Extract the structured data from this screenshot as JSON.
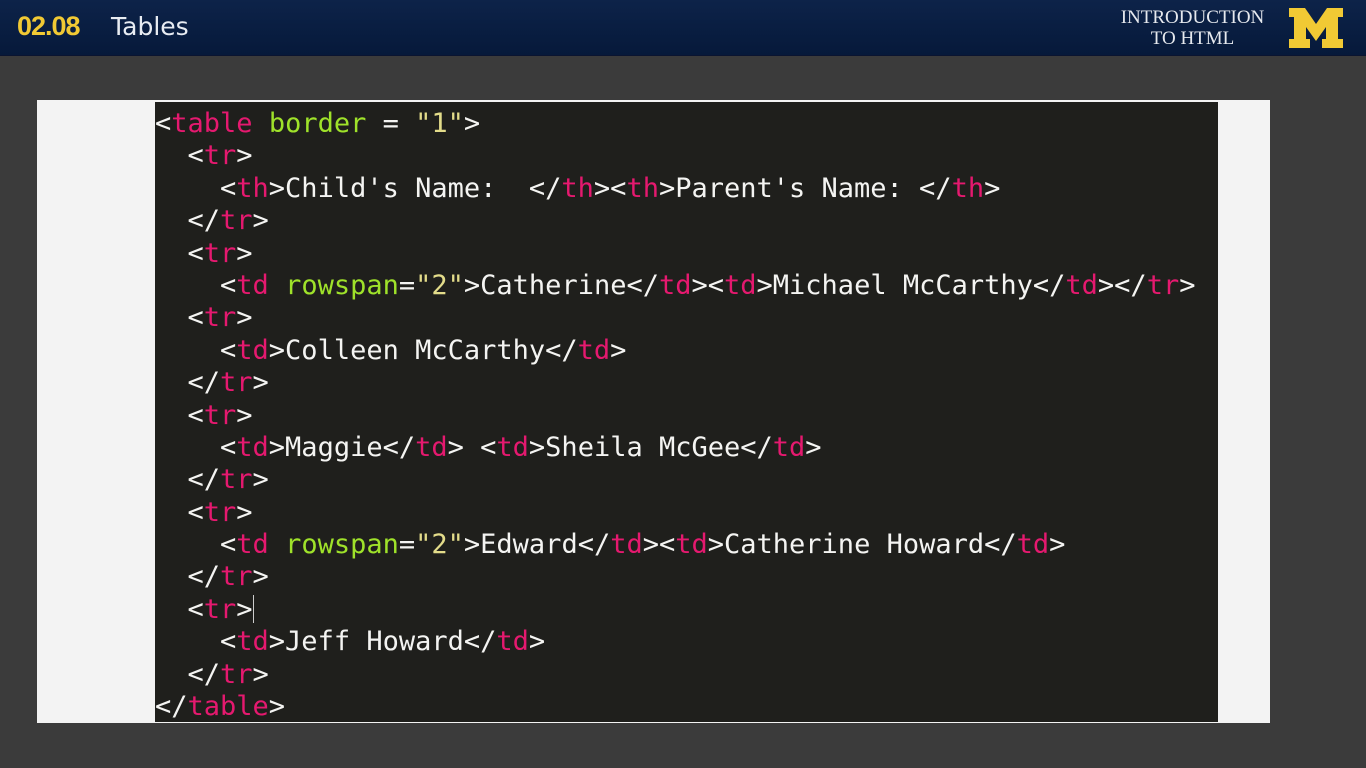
{
  "header": {
    "number": "02.08",
    "title": "Tables",
    "course_line1": "INTRODUCTION",
    "course_line2": "TO HTML",
    "logo": "Block M"
  },
  "colors": {
    "header_bg": "#0d2349",
    "number": "#f1c934",
    "logo": "#f1c934",
    "tag": "#e5196f",
    "attribute": "#9fe22a",
    "string": "#e3dc8a",
    "text": "#f4f4f2",
    "editor_bg": "#1f1f1c"
  },
  "code": [
    [
      [
        "txt",
        "<"
      ],
      [
        "tag",
        "table"
      ],
      [
        "txt",
        " "
      ],
      [
        "attr",
        "border"
      ],
      [
        "txt",
        " = "
      ],
      [
        "str",
        "\"1\""
      ],
      [
        "txt",
        ">"
      ]
    ],
    [
      [
        "txt",
        "  <"
      ],
      [
        "tag",
        "tr"
      ],
      [
        "txt",
        ">"
      ]
    ],
    [
      [
        "txt",
        "    <"
      ],
      [
        "tag",
        "th"
      ],
      [
        "txt",
        ">Child's Name:  </"
      ],
      [
        "tag",
        "th"
      ],
      [
        "txt",
        "><"
      ],
      [
        "tag",
        "th"
      ],
      [
        "txt",
        ">Parent's Name: </"
      ],
      [
        "tag",
        "th"
      ],
      [
        "txt",
        ">"
      ]
    ],
    [
      [
        "txt",
        "  </"
      ],
      [
        "tag",
        "tr"
      ],
      [
        "txt",
        ">"
      ]
    ],
    [
      [
        "txt",
        "  <"
      ],
      [
        "tag",
        "tr"
      ],
      [
        "txt",
        ">"
      ]
    ],
    [
      [
        "txt",
        "    <"
      ],
      [
        "tag",
        "td"
      ],
      [
        "txt",
        " "
      ],
      [
        "attr",
        "rowspan"
      ],
      [
        "txt",
        "="
      ],
      [
        "str",
        "\"2\""
      ],
      [
        "txt",
        ">Catherine</"
      ],
      [
        "tag",
        "td"
      ],
      [
        "txt",
        "><"
      ],
      [
        "tag",
        "td"
      ],
      [
        "txt",
        ">Michael McCarthy</"
      ],
      [
        "tag",
        "td"
      ],
      [
        "txt",
        "></"
      ],
      [
        "tag",
        "tr"
      ],
      [
        "txt",
        ">"
      ]
    ],
    [
      [
        "txt",
        "  <"
      ],
      [
        "tag",
        "tr"
      ],
      [
        "txt",
        ">"
      ]
    ],
    [
      [
        "txt",
        "    <"
      ],
      [
        "tag",
        "td"
      ],
      [
        "txt",
        ">Colleen McCarthy</"
      ],
      [
        "tag",
        "td"
      ],
      [
        "txt",
        ">"
      ]
    ],
    [
      [
        "txt",
        "  </"
      ],
      [
        "tag",
        "tr"
      ],
      [
        "txt",
        ">"
      ]
    ],
    [
      [
        "txt",
        "  <"
      ],
      [
        "tag",
        "tr"
      ],
      [
        "txt",
        ">"
      ]
    ],
    [
      [
        "txt",
        "    <"
      ],
      [
        "tag",
        "td"
      ],
      [
        "txt",
        ">Maggie</"
      ],
      [
        "tag",
        "td"
      ],
      [
        "txt",
        "> <"
      ],
      [
        "tag",
        "td"
      ],
      [
        "txt",
        ">Sheila McGee</"
      ],
      [
        "tag",
        "td"
      ],
      [
        "txt",
        ">"
      ]
    ],
    [
      [
        "txt",
        "  </"
      ],
      [
        "tag",
        "tr"
      ],
      [
        "txt",
        ">"
      ]
    ],
    [
      [
        "txt",
        "  <"
      ],
      [
        "tag",
        "tr"
      ],
      [
        "txt",
        ">"
      ]
    ],
    [
      [
        "txt",
        "    <"
      ],
      [
        "tag",
        "td"
      ],
      [
        "txt",
        " "
      ],
      [
        "attr",
        "rowspan"
      ],
      [
        "txt",
        "="
      ],
      [
        "str",
        "\"2\""
      ],
      [
        "txt",
        ">Edward</"
      ],
      [
        "tag",
        "td"
      ],
      [
        "txt",
        "><"
      ],
      [
        "tag",
        "td"
      ],
      [
        "txt",
        ">Catherine Howard</"
      ],
      [
        "tag",
        "td"
      ],
      [
        "txt",
        ">"
      ]
    ],
    [
      [
        "txt",
        "  </"
      ],
      [
        "tag",
        "tr"
      ],
      [
        "txt",
        ">"
      ]
    ],
    [
      [
        "txt",
        "  <"
      ],
      [
        "tag",
        "tr"
      ],
      [
        "txt",
        ">"
      ]
    ],
    [
      [
        "txt",
        "    <"
      ],
      [
        "tag",
        "td"
      ],
      [
        "txt",
        ">Jeff Howard</"
      ],
      [
        "tag",
        "td"
      ],
      [
        "txt",
        ">"
      ]
    ],
    [
      [
        "txt",
        "  </"
      ],
      [
        "tag",
        "tr"
      ],
      [
        "txt",
        ">"
      ]
    ],
    [
      [
        "txt",
        "</"
      ],
      [
        "tag",
        "table"
      ],
      [
        "txt",
        ">"
      ]
    ]
  ],
  "cursor_line": 15
}
